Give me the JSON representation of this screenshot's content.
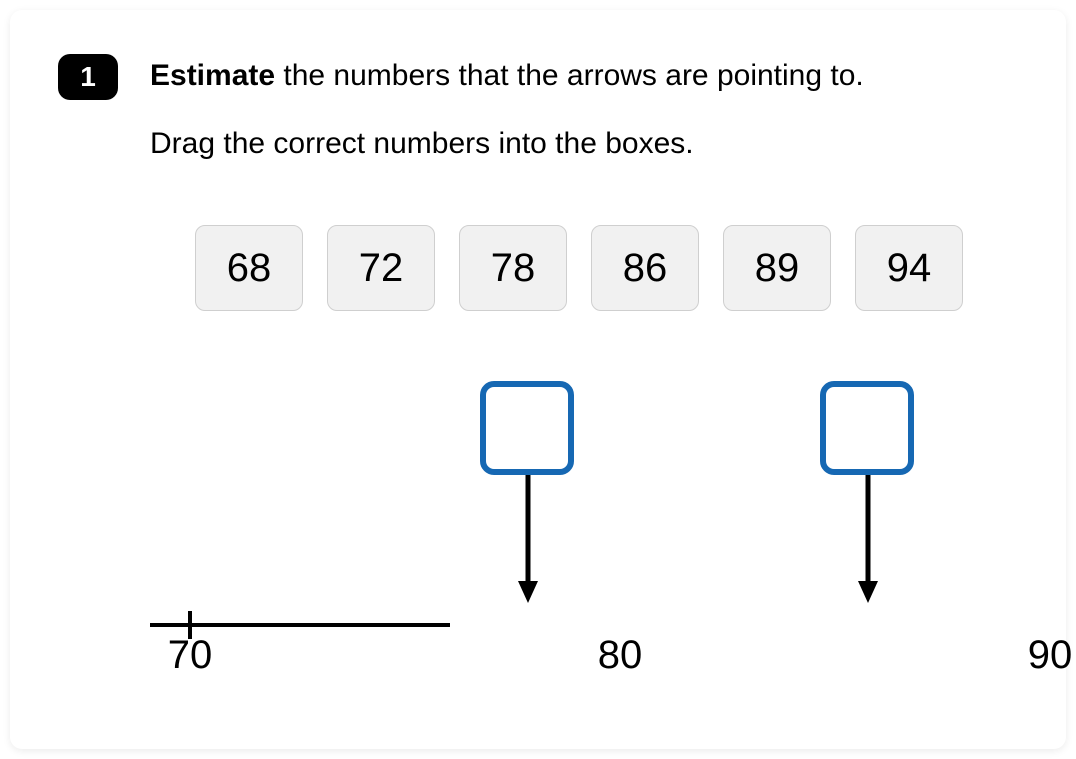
{
  "question": {
    "number": "1",
    "line1_bold": "Estimate",
    "line1_rest": " the numbers that the arrows are pointing to.",
    "line2": "Drag the correct numbers into the boxes."
  },
  "choices": [
    "68",
    "72",
    "78",
    "86",
    "89",
    "94"
  ],
  "number_line": {
    "ticks": [
      "70",
      "80",
      "90"
    ]
  },
  "chart_data": {
    "type": "number_line",
    "axis_min": 70,
    "axis_max": 90,
    "ticks": [
      70,
      80,
      90
    ],
    "arrows_point_to": [
      78,
      86
    ],
    "answer_choices": [
      68,
      72,
      78,
      86,
      89,
      94
    ]
  }
}
